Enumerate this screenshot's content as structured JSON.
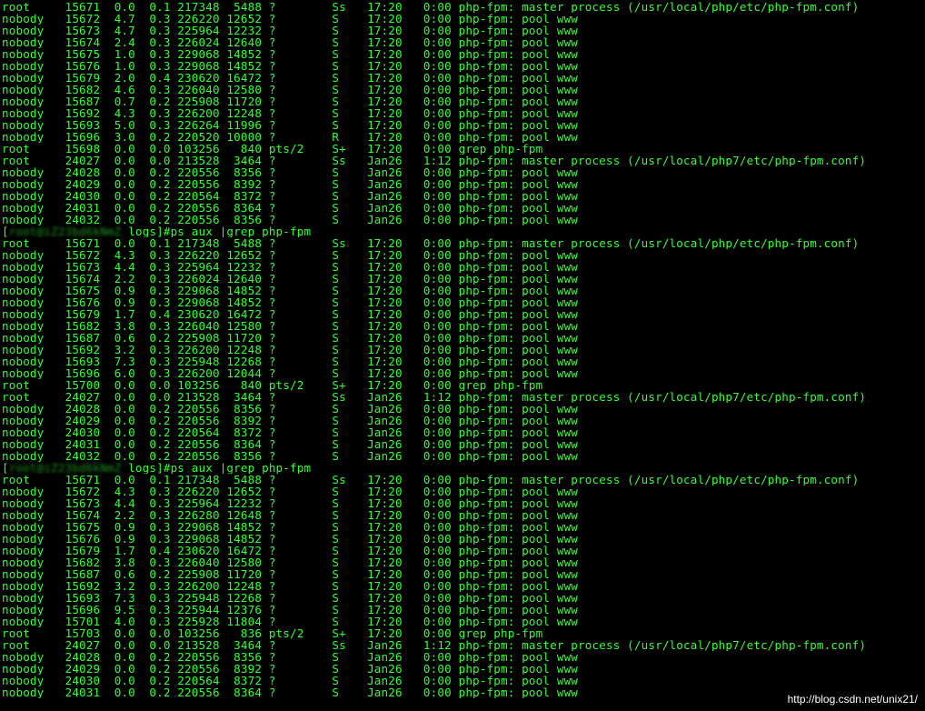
{
  "terminal": {
    "prompt_prefix": "[",
    "blurred_host": "root@iZ23bd6kNmZ",
    "prompt_cwd": " logs]#",
    "command": "ps aux |grep php-fpm",
    "blocks": [
      {
        "has_prompt": false,
        "lines": [
          "root     15671  0.0  0.1 217348  5488 ?        Ss   17:20   0:00 php-fpm: master process (/usr/local/php/etc/php-fpm.conf)",
          "nobody   15672  4.7  0.3 226220 12652 ?        S    17:20   0:00 php-fpm: pool www",
          "nobody   15673  4.7  0.3 225964 12232 ?        S    17:20   0:00 php-fpm: pool www",
          "nobody   15674  2.4  0.3 226024 12640 ?        S    17:20   0:00 php-fpm: pool www",
          "nobody   15675  1.0  0.3 229068 14852 ?        S    17:20   0:00 php-fpm: pool www",
          "nobody   15676  1.0  0.3 229068 14852 ?        S    17:20   0:00 php-fpm: pool www",
          "nobody   15679  2.0  0.4 230620 16472 ?        S    17:20   0:00 php-fpm: pool www",
          "nobody   15682  4.6  0.3 226040 12580 ?        S    17:20   0:00 php-fpm: pool www",
          "nobody   15687  0.7  0.2 225908 11720 ?        S    17:20   0:00 php-fpm: pool www",
          "nobody   15692  4.3  0.3 226200 12248 ?        S    17:20   0:00 php-fpm: pool www",
          "nobody   15693  5.0  0.3 226264 11996 ?        S    17:20   0:00 php-fpm: pool www",
          "nobody   15696  3.0  0.2 220520 10000 ?        R    17:20   0:00 php-fpm: pool www",
          "root     15698  0.0  0.0 103256   840 pts/2    S+   17:20   0:00 grep php-fpm",
          "root     24027  0.0  0.0 213528  3464 ?        Ss   Jan26   1:12 php-fpm: master process (/usr/local/php7/etc/php-fpm.conf)",
          "nobody   24028  0.0  0.2 220556  8356 ?        S    Jan26   0:00 php-fpm: pool www",
          "nobody   24029  0.0  0.2 220556  8392 ?        S    Jan26   0:00 php-fpm: pool www",
          "nobody   24030  0.0  0.2 220564  8372 ?        S    Jan26   0:00 php-fpm: pool www",
          "nobody   24031  0.0  0.2 220556  8364 ?        S    Jan26   0:00 php-fpm: pool www",
          "nobody   24032  0.0  0.2 220556  8356 ?        S    Jan26   0:00 php-fpm: pool www"
        ]
      },
      {
        "has_prompt": true,
        "lines": [
          "root     15671  0.0  0.1 217348  5488 ?        Ss   17:20   0:00 php-fpm: master process (/usr/local/php/etc/php-fpm.conf)",
          "nobody   15672  4.3  0.3 226220 12652 ?        S    17:20   0:00 php-fpm: pool www",
          "nobody   15673  4.4  0.3 225964 12232 ?        S    17:20   0:00 php-fpm: pool www",
          "nobody   15674  2.2  0.3 226024 12640 ?        S    17:20   0:00 php-fpm: pool www",
          "nobody   15675  0.9  0.3 229068 14852 ?        S    17:20   0:00 php-fpm: pool www",
          "nobody   15676  0.9  0.3 229068 14852 ?        S    17:20   0:00 php-fpm: pool www",
          "nobody   15679  1.7  0.4 230620 16472 ?        S    17:20   0:00 php-fpm: pool www",
          "nobody   15682  3.8  0.3 226040 12580 ?        S    17:20   0:00 php-fpm: pool www",
          "nobody   15687  0.6  0.2 225908 11720 ?        S    17:20   0:00 php-fpm: pool www",
          "nobody   15692  3.2  0.3 226200 12248 ?        S    17:20   0:00 php-fpm: pool www",
          "nobody   15693  7.3  0.3 225948 12268 ?        S    17:20   0:00 php-fpm: pool www",
          "nobody   15696  6.0  0.3 226200 12044 ?        S    17:20   0:00 php-fpm: pool www",
          "root     15700  0.0  0.0 103256   840 pts/2    S+   17:20   0:00 grep php-fpm",
          "root     24027  0.0  0.0 213528  3464 ?        Ss   Jan26   1:12 php-fpm: master process (/usr/local/php7/etc/php-fpm.conf)",
          "nobody   24028  0.0  0.2 220556  8356 ?        S    Jan26   0:00 php-fpm: pool www",
          "nobody   24029  0.0  0.2 220556  8392 ?        S    Jan26   0:00 php-fpm: pool www",
          "nobody   24030  0.0  0.2 220564  8372 ?        S    Jan26   0:00 php-fpm: pool www",
          "nobody   24031  0.0  0.2 220556  8364 ?        S    Jan26   0:00 php-fpm: pool www",
          "nobody   24032  0.0  0.2 220556  8356 ?        S    Jan26   0:00 php-fpm: pool www"
        ]
      },
      {
        "has_prompt": true,
        "lines": [
          "root     15671  0.0  0.1 217348  5488 ?        Ss   17:20   0:00 php-fpm: master process (/usr/local/php/etc/php-fpm.conf)",
          "nobody   15672  4.3  0.3 226220 12652 ?        S    17:20   0:00 php-fpm: pool www",
          "nobody   15673  4.4  0.3 225964 12232 ?        S    17:20   0:00 php-fpm: pool www",
          "nobody   15674  2.2  0.3 226280 12648 ?        S    17:20   0:00 php-fpm: pool www",
          "nobody   15675  0.9  0.3 229068 14852 ?        S    17:20   0:00 php-fpm: pool www",
          "nobody   15676  0.9  0.3 229068 14852 ?        S    17:20   0:00 php-fpm: pool www",
          "nobody   15679  1.7  0.4 230620 16472 ?        S    17:20   0:00 php-fpm: pool www",
          "nobody   15682  3.8  0.3 226040 12580 ?        S    17:20   0:00 php-fpm: pool www",
          "nobody   15687  0.6  0.2 225908 11720 ?        S    17:20   0:00 php-fpm: pool www",
          "nobody   15692  3.2  0.3 226200 12248 ?        S    17:20   0:00 php-fpm: pool www",
          "nobody   15693  7.3  0.3 225948 12268 ?        S    17:20   0:00 php-fpm: pool www",
          "nobody   15696  9.5  0.3 225944 12376 ?        S    17:20   0:00 php-fpm: pool www",
          "nobody   15701  4.0  0.3 225928 11804 ?        S    17:20   0:00 php-fpm: pool www",
          "root     15703  0.0  0.0 103256   836 pts/2    S+   17:20   0:00 grep php-fpm",
          "root     24027  0.0  0.0 213528  3464 ?        Ss   Jan26   1:12 php-fpm: master process (/usr/local/php7/etc/php-fpm.conf)",
          "nobody   24028  0.0  0.2 220556  8356 ?        S    Jan26   0:00 php-fpm: pool www",
          "nobody   24029  0.0  0.2 220556  8392 ?        S    Jan26   0:00 php-fpm: pool www",
          "nobody   24030  0.0  0.2 220564  8372 ?        S    Jan26   0:00 php-fpm: pool www",
          "nobody   24031  0.0  0.2 220556  8364 ?        S    Jan26   0:00 php-fpm: pool www"
        ]
      }
    ]
  },
  "watermark": "http://blog.csdn.net/unix21/"
}
